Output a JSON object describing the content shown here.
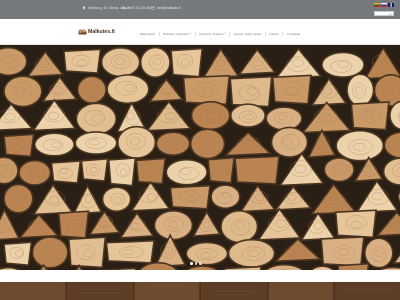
{
  "topbar": {
    "address": "Vilniaus g. 15, Vilnius, Lietuva",
    "phone": "+370 612 34 567",
    "email": "info@malkutes.lt",
    "languages": [
      "lt",
      "en",
      "ru"
    ],
    "search_placeholder": ""
  },
  "logo": {
    "text": "Malkutes.lt"
  },
  "menu": {
    "items": [
      {
        "label": "Pagrindinis",
        "has_dropdown": false
      },
      {
        "label": "Briketai / Granulės",
        "has_dropdown": true
      },
      {
        "label": "Pjautinė / Paletės",
        "has_dropdown": true
      },
      {
        "label": "Lentos, tašai, rąstai",
        "has_dropdown": false
      },
      {
        "label": "Kainos",
        "has_dropdown": false
      },
      {
        "label": "Kontaktai",
        "has_dropdown": false
      }
    ]
  },
  "hero": {
    "slides_total": 3,
    "active_slide": 1
  },
  "colors": {
    "topbar": "#767a7e",
    "nav_text": "#7d7d7d",
    "logo_brown": "#4b3420",
    "wood_light": "#e7c8a0",
    "wood_bark": "#3e2c1c",
    "floor": "#5a3a24"
  },
  "icons": [
    "map-pin-icon",
    "phone-icon",
    "mail-icon",
    "search-icon",
    "flag-lt-icon",
    "flag-en-icon",
    "flag-ru-icon",
    "logo-mark-icon",
    "chevron-down-icon"
  ]
}
